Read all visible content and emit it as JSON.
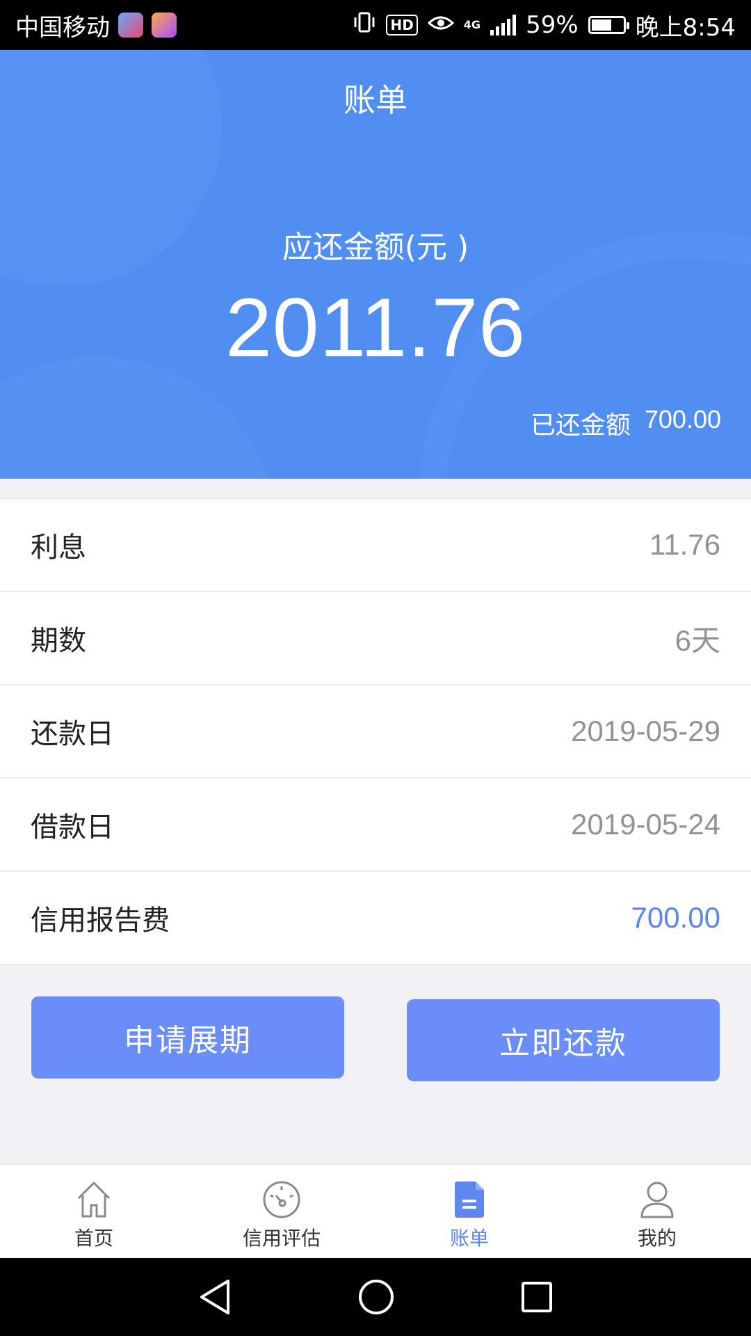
{
  "status_bar": {
    "carrier": "中国移动",
    "hd": "HD",
    "network": "4G",
    "battery_percent": "59%",
    "time": "晚上8:54"
  },
  "header": {
    "title": "账单",
    "amount_label": "应还金额(元 )",
    "amount_value": "2011.76",
    "paid_label": "已还金额",
    "paid_value": "700.00",
    "bg_color": "#518ef2"
  },
  "details": [
    {
      "label": "利息",
      "value": "11.76"
    },
    {
      "label": "期数",
      "value": "6天"
    },
    {
      "label": "还款日",
      "value": "2019-05-29"
    },
    {
      "label": "借款日",
      "value": "2019-05-24"
    },
    {
      "label": "信用报告费",
      "value": "700.00",
      "accent_color": "#5c86ee"
    }
  ],
  "actions": {
    "extend_label": "申请展期",
    "repay_label": "立即还款",
    "button_color": "#6a8ef9"
  },
  "bottom_nav": {
    "items": [
      {
        "label": "首页",
        "icon": "home-icon"
      },
      {
        "label": "信用评估",
        "icon": "gauge-icon"
      },
      {
        "label": "账单",
        "icon": "bill-icon",
        "active": true
      },
      {
        "label": "我的",
        "icon": "user-icon"
      }
    ],
    "active_color": "#5f86ee"
  },
  "system_nav": {
    "icons": [
      "back-icon",
      "home-circle-icon",
      "recents-icon"
    ]
  }
}
